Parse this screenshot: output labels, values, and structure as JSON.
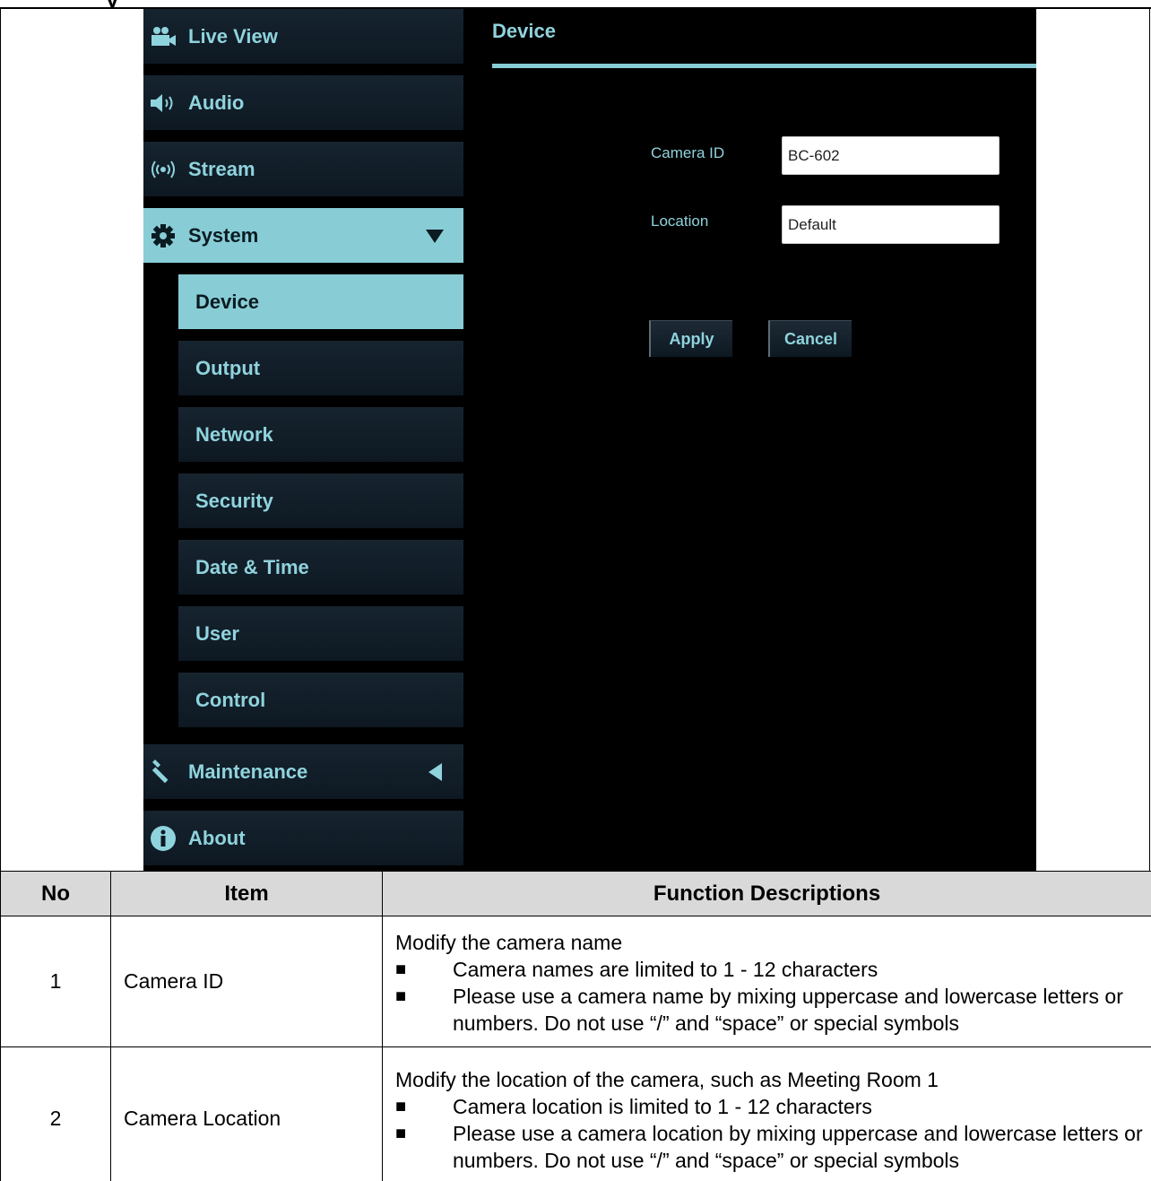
{
  "nav": {
    "items": [
      {
        "label": "Live View",
        "icon": "video-camera-icon"
      },
      {
        "label": "Audio",
        "icon": "speaker-icon"
      },
      {
        "label": "Stream",
        "icon": "broadcast-icon"
      },
      {
        "label": "System",
        "icon": "gear-icon",
        "expanded": true
      },
      {
        "label": "Maintenance",
        "icon": "wrench-icon",
        "expanded": false
      },
      {
        "label": "About",
        "icon": "info-icon"
      }
    ],
    "system_subitems": [
      {
        "label": "Device",
        "active": true
      },
      {
        "label": "Output"
      },
      {
        "label": "Network"
      },
      {
        "label": "Security"
      },
      {
        "label": "Date & Time"
      },
      {
        "label": "User"
      },
      {
        "label": "Control"
      }
    ]
  },
  "device_page": {
    "title": "Device",
    "camera_id_label": "Camera ID",
    "camera_id_value": "BC-602",
    "location_label": "Location",
    "location_value": "Default",
    "apply_label": "Apply",
    "cancel_label": "Cancel"
  },
  "table": {
    "headers": [
      "No",
      "Item",
      "Function Descriptions"
    ],
    "rows": [
      {
        "no": "1",
        "item": "Camera ID",
        "intro": "Modify the camera name",
        "bullets": [
          "Camera names are limited to 1 - 12 characters",
          "Please use a camera name by mixing uppercase and lowercase letters or numbers. Do not use “/” and “space” or special symbols"
        ]
      },
      {
        "no": "2",
        "item": "Camera Location",
        "intro": "Modify the location of the camera, such as Meeting Room 1",
        "bullets": [
          "Camera location is limited to 1 - 12 characters",
          "Please use a camera location by mixing uppercase and lowercase letters or numbers. Do not use “/” and “space” or special symbols"
        ]
      }
    ]
  },
  "colors": {
    "accent": "#88cdd6",
    "nav_text": "#8fd3dd",
    "background": "#000000",
    "table_header": "#d9d9d9"
  }
}
